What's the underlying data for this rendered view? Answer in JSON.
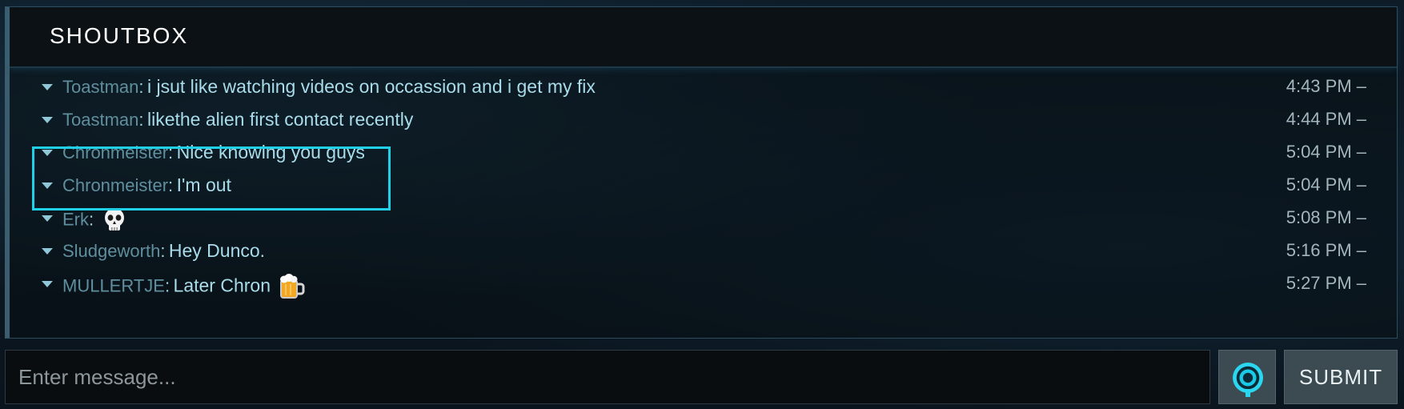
{
  "header": {
    "title": "SHOUTBOX"
  },
  "messages": [
    {
      "user": "Toastman",
      "text": "i jsut like watching videos on occassion and i get my fix",
      "time": "4:43 PM –"
    },
    {
      "user": "Toastman",
      "text": "likethe alien first contact recently",
      "time": "4:44 PM –"
    },
    {
      "user": "Chronmeister",
      "text": "Nice knowing you guys",
      "time": "5:04 PM –"
    },
    {
      "user": "Chronmeister",
      "text": "I'm out",
      "time": "5:04 PM –"
    },
    {
      "user": "Erk",
      "text": "",
      "emoji": "skull-emoji",
      "time": "5:08 PM –"
    },
    {
      "user": "Sludgeworth",
      "text": "Hey Dunco.",
      "time": "5:16 PM –"
    },
    {
      "user": "MULLERTJE",
      "text": "Later Chron",
      "emoji": "beer-mug-emoji",
      "time": "5:27 PM –"
    }
  ],
  "separator": ":",
  "input": {
    "placeholder": "Enter message..."
  },
  "emoji_button": {
    "icon": "emoticon-icon"
  },
  "submit": {
    "label": "SUBMIT"
  },
  "colors": {
    "highlight": "#1fd0e6",
    "username": "#5f8f9e",
    "message": "#a9dcea",
    "accent_icon": "#2ad6f0"
  }
}
